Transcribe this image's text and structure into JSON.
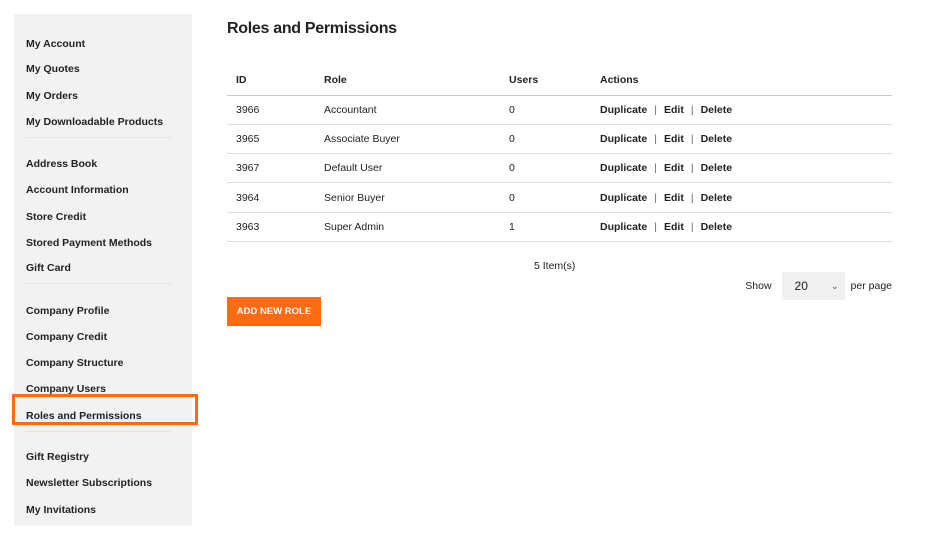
{
  "sidebar": {
    "items": [
      "My Account",
      "My Quotes",
      "My Orders",
      "My Downloadable Products",
      "Address Book",
      "Account Information",
      "Store Credit",
      "Stored Payment Methods",
      "Gift Card",
      "Company Profile",
      "Company Credit",
      "Company Structure",
      "Company Users",
      "Roles and Permissions",
      "Gift Registry",
      "Newsletter Subscriptions",
      "My Invitations"
    ],
    "active": "Roles and Permissions",
    "highlight_color": "#ff6a13"
  },
  "page": {
    "title": "Roles and Permissions"
  },
  "table": {
    "headers": [
      "ID",
      "Role",
      "Users",
      "Actions"
    ],
    "rows": [
      [
        "3966",
        "Accountant",
        "0"
      ],
      [
        "3965",
        "Associate Buyer",
        "0"
      ],
      [
        "3967",
        "Default User",
        "0"
      ],
      [
        "3964",
        "Senior Buyer",
        "0"
      ],
      [
        "3963",
        "Super Admin",
        "1"
      ]
    ],
    "actions": [
      "Duplicate",
      "Edit",
      "Delete"
    ],
    "separator": "|"
  },
  "count": "5 Item(s)",
  "pager": {
    "show": "Show",
    "value": "20",
    "per_page": "per page"
  },
  "add_button": "ADD NEW ROLE"
}
